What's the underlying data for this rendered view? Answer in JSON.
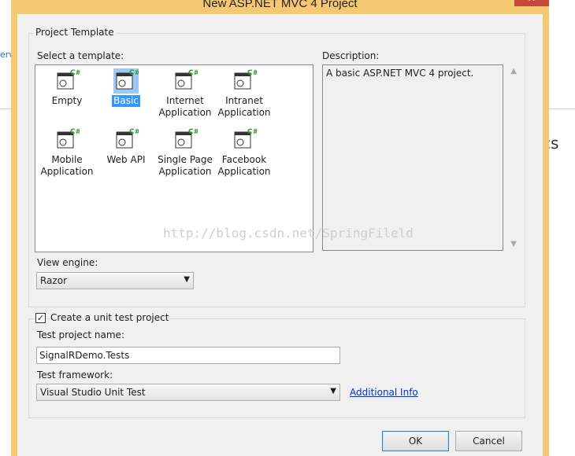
{
  "background": {
    "left_fragment": "ervi",
    "right_fragment": "cs"
  },
  "window": {
    "title": "New ASP.NET MVC 4 Project",
    "close": "✕"
  },
  "project_template": {
    "group_label": "Project Template",
    "select_label": "Select a template:",
    "templates": [
      {
        "name": "Empty",
        "selected": false
      },
      {
        "name": "Basic",
        "selected": true
      },
      {
        "name": "Internet Application",
        "selected": false
      },
      {
        "name": "Intranet Application",
        "selected": false
      },
      {
        "name": "Mobile Application",
        "selected": false
      },
      {
        "name": "Web API",
        "selected": false
      },
      {
        "name": "Single Page Application",
        "selected": false
      },
      {
        "name": "Facebook Application",
        "selected": false
      }
    ],
    "template_icon": "csharp-web-project-icon",
    "description_label": "Description:",
    "description": "A basic ASP.NET MVC 4 project.",
    "view_engine_label": "View engine:",
    "view_engine_value": "Razor"
  },
  "unit_test": {
    "create_label": "Create a unit test project",
    "create_checked": true,
    "name_label": "Test project name:",
    "name_value": "SignalRDemo.Tests",
    "framework_label": "Test framework:",
    "framework_value": "Visual Studio Unit Test",
    "additional_info": "Additional Info"
  },
  "buttons": {
    "ok": "OK",
    "cancel": "Cancel"
  },
  "watermark": "http://blog.csdn.net/SpringFileld",
  "colors": {
    "frame": "#f7c873",
    "selection": "#3399ff",
    "link": "#0033cc"
  }
}
